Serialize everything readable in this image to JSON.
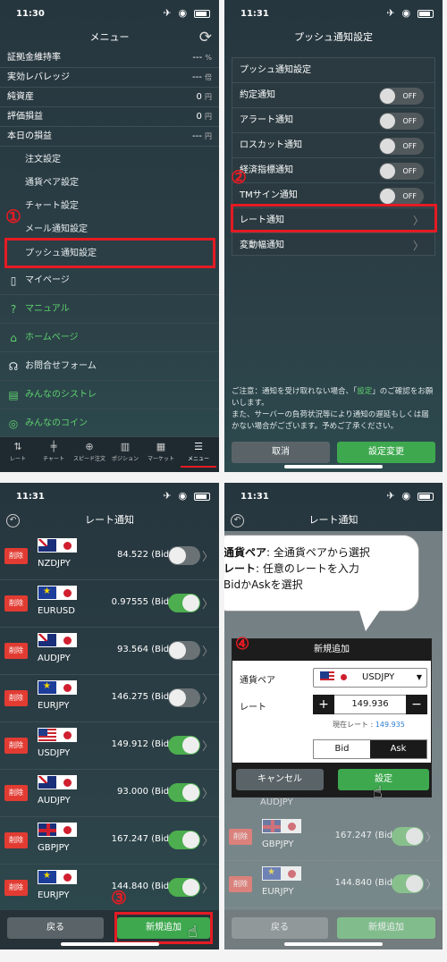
{
  "status": {
    "time": "11:30",
    "time2": "11:31"
  },
  "menu": {
    "title": "メニュー",
    "stats": [
      {
        "label": "証拠金維持率",
        "value": "---",
        "unit": "%"
      },
      {
        "label": "実効レバレッジ",
        "value": "---",
        "unit": "倍"
      },
      {
        "label": "純資産",
        "value": "0",
        "unit": "円"
      },
      {
        "label": "評価損益",
        "value": "0",
        "unit": "円"
      },
      {
        "label": "本日の損益",
        "value": "---",
        "unit": "円"
      }
    ],
    "items": [
      "注文設定",
      "通貨ペア設定",
      "チャート設定",
      "メール通知設定",
      "プッシュ通知設定"
    ],
    "side": [
      {
        "label": "マイページ",
        "icon": "document-icon",
        "green": false
      },
      {
        "label": "マニュアル",
        "icon": "help-icon",
        "green": true
      },
      {
        "label": "ホームページ",
        "icon": "home-icon",
        "green": true
      },
      {
        "label": "お問合せフォーム",
        "icon": "headset-icon",
        "green": false
      },
      {
        "label": "みんなのシストレ",
        "icon": "systrade-icon",
        "green": true
      },
      {
        "label": "みんなのコイン",
        "icon": "coin-icon",
        "green": true
      }
    ],
    "tabs": [
      "レート",
      "チャート",
      "スピード注文",
      "ポジション",
      "マーケット",
      "メニュー"
    ],
    "step": "①"
  },
  "push": {
    "title": "プッシュ通知設定",
    "section": "プッシュ通知設定",
    "toggles": [
      {
        "label": "約定通知",
        "state": "OFF"
      },
      {
        "label": "アラート通知",
        "state": "OFF"
      },
      {
        "label": "ロスカット通知",
        "state": "OFF"
      },
      {
        "label": "経済指標通知",
        "state": "OFF"
      },
      {
        "label": "TMサイン通知",
        "state": "OFF"
      }
    ],
    "rate_notice": "レート通知",
    "change_notice": "変動幅通知",
    "note_pre": "ご注意：通知を受け取れない場合、「",
    "note_link": "設定",
    "note_post": "」のご確認をお願いします。",
    "note2": "また、サーバーの負荷状況等により通知の遅延もしくは届かない場合がございます。予めご了承ください。",
    "cancel": "取消",
    "apply": "設定変更",
    "step": "②"
  },
  "rates": {
    "title": "レート通知",
    "delete": "削除",
    "rows": [
      {
        "pair": "NZDJPY",
        "rate": "84.522 (Bid)",
        "on": false,
        "flag": "nz"
      },
      {
        "pair": "EURUSD",
        "rate": "0.97555 (Bid)",
        "on": true,
        "flag": "eu"
      },
      {
        "pair": "AUDJPY",
        "rate": "93.564 (Bid)",
        "on": false,
        "flag": "au"
      },
      {
        "pair": "EURJPY",
        "rate": "146.275 (Bid)",
        "on": false,
        "flag": "eu"
      },
      {
        "pair": "USDJPY",
        "rate": "149.912 (Bid)",
        "on": true,
        "flag": "us"
      },
      {
        "pair": "AUDJPY",
        "rate": "93.000 (Bid)",
        "on": true,
        "flag": "au"
      },
      {
        "pair": "GBPJPY",
        "rate": "167.247 (Bid)",
        "on": true,
        "flag": "gb"
      },
      {
        "pair": "EURJPY",
        "rate": "144.840 (Bid)",
        "on": true,
        "flag": "eu"
      }
    ],
    "back": "戻る",
    "add": "新規追加",
    "step": "③"
  },
  "dialog": {
    "bubble_l1_b": "通貨ペア",
    "bubble_l1": ": 全通貨ペアから選択",
    "bubble_l2_b": "レート",
    "bubble_l2": ": 任意のレートを入力",
    "bubble_l3": "BidかAskを選択",
    "step": "④",
    "title": "新規追加",
    "pair_label": "通貨ペア",
    "pair_value": "USDJPY",
    "rate_label": "レート",
    "rate_value": "149.936",
    "current_label": "現在レート : ",
    "current_value": "149.935",
    "bid": "Bid",
    "ask": "Ask",
    "cancel": "キャンセル",
    "ok": "設定",
    "behind_pair": "AUDJPY",
    "rows": [
      {
        "pair": "GBPJPY",
        "rate": "167.247 (Bid)"
      },
      {
        "pair": "EURJPY",
        "rate": "144.840 (Bid)"
      }
    ],
    "back": "戻る",
    "add": "新規追加"
  }
}
